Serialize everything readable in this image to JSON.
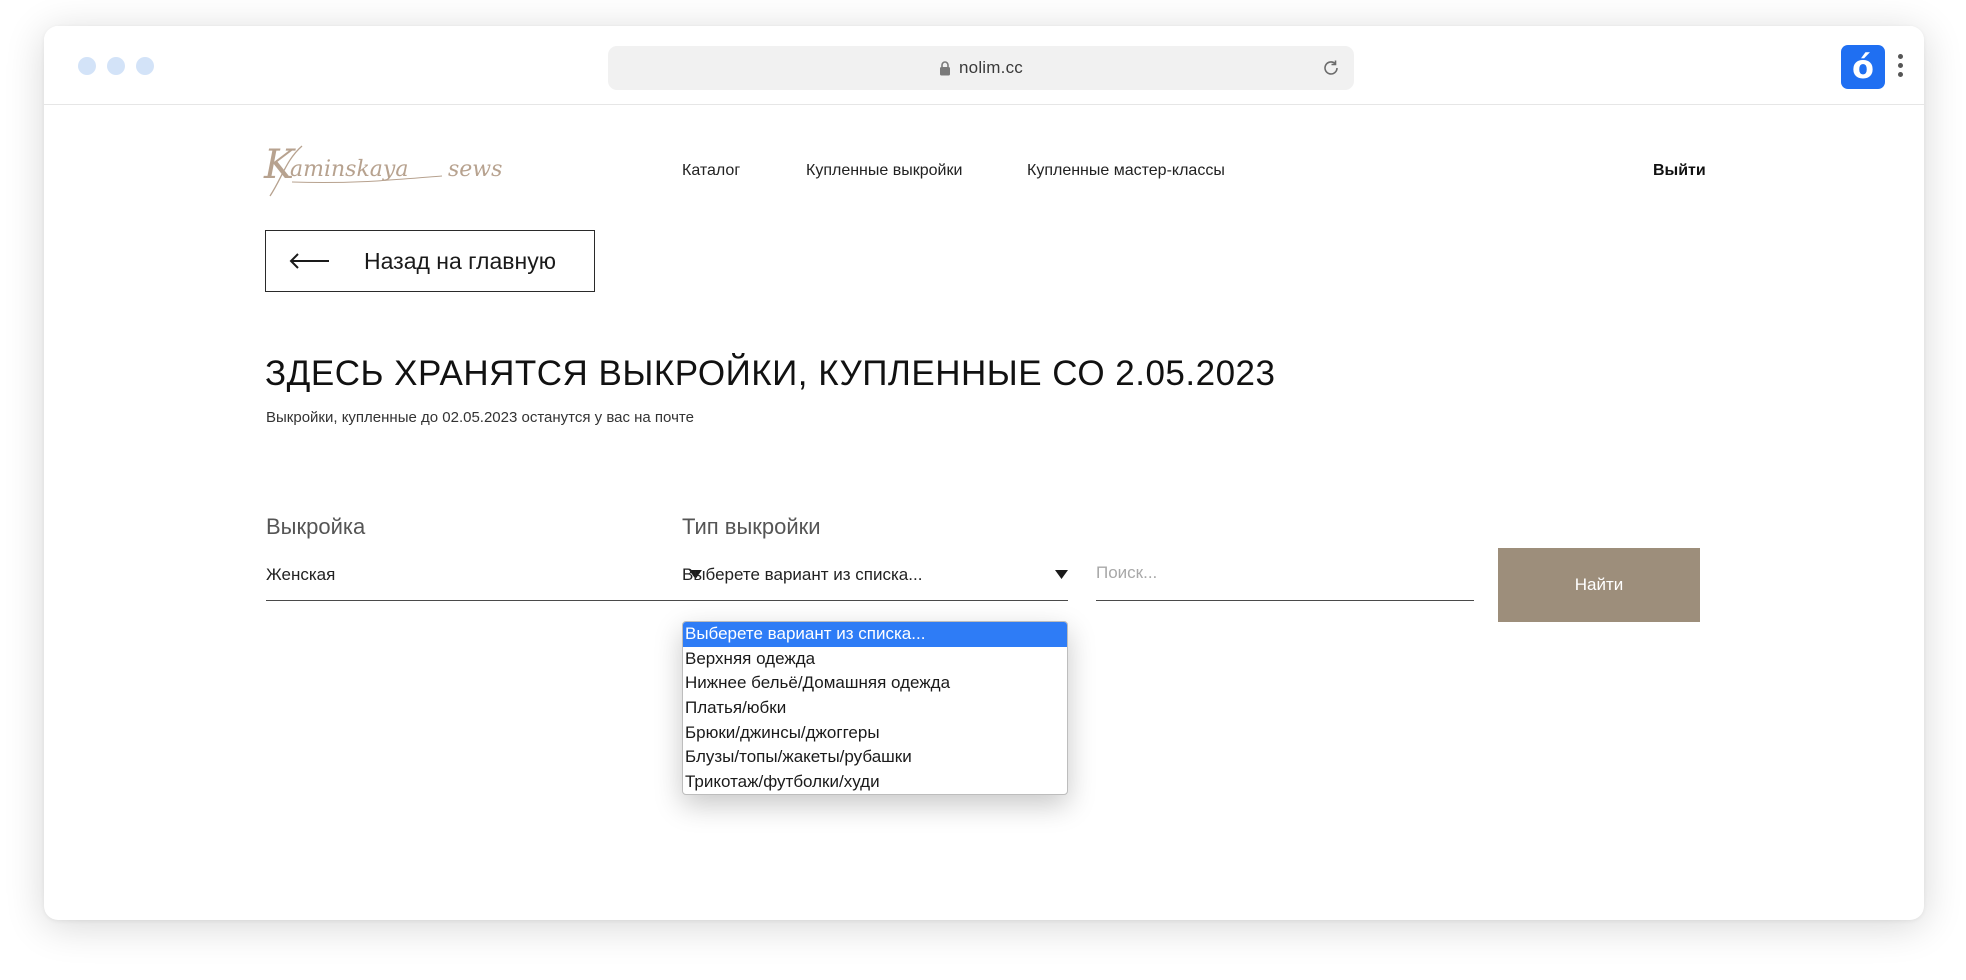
{
  "browser": {
    "url": "nolim.cc"
  },
  "header": {
    "logo_text": "Kaminskaya sews",
    "nav": [
      {
        "label": "Каталог"
      },
      {
        "label": "Купленные выкройки"
      },
      {
        "label": "Купленные мастер-классы"
      }
    ],
    "logout_label": "Выйти"
  },
  "back_button": {
    "label": "Назад на главную"
  },
  "page": {
    "title": "ЗДЕСЬ ХРАНЯТСЯ ВЫКРОЙКИ, КУПЛЕННЫЕ СО 2.05.2023",
    "subtitle": "Выкройки, купленные до 02.05.2023 останутся у вас на почте"
  },
  "filters": {
    "pattern_label": "Выкройка",
    "pattern_value": "Женская",
    "type_label": "Тип выкройки",
    "type_value": "Выберете вариант из списка...",
    "search_placeholder": "Поиск...",
    "search_value": "",
    "find_label": "Найти"
  },
  "type_dropdown": {
    "options": [
      {
        "label": "Выберете вариант из списка...",
        "selected": true
      },
      {
        "label": "Верхняя одежда"
      },
      {
        "label": "Нижнее бельё/Домашняя одежда"
      },
      {
        "label": "Платья/юбки"
      },
      {
        "label": "Брюки/джинсы/джоггеры"
      },
      {
        "label": "Блузы/топы/жакеты/рубашки"
      },
      {
        "label": "Трикотаж/футболки/худи"
      }
    ]
  },
  "colors": {
    "accent": "#9d8e7b",
    "logo": "#b7a28f",
    "selection": "#2e7cf6",
    "extension": "#1f6ff2"
  }
}
